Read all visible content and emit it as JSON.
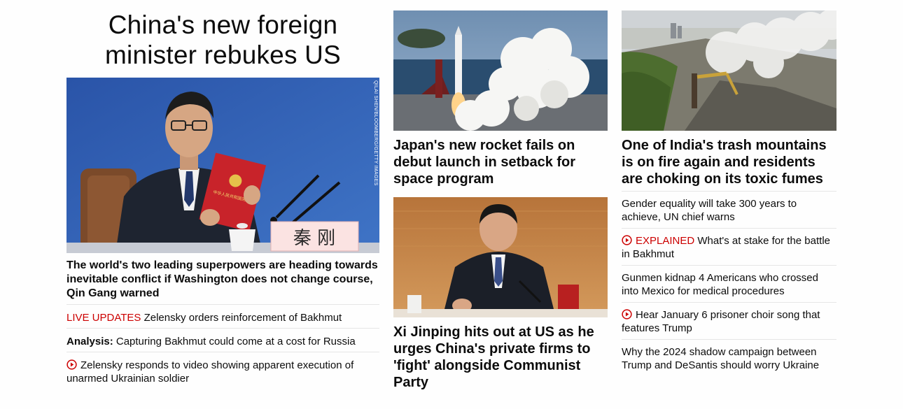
{
  "lead": {
    "headline": "China's new foreign minister rebukes US",
    "image_credit": "QILAI SHEN/BLOOMBERG/GETTY IMAGES",
    "nameplate_text": "秦  刚",
    "book_text": "中华人民共和国宪法",
    "caption": "The world's two leading superpowers are heading towards inevitable conflict if Washington does not change course, Qin Gang warned",
    "related": [
      {
        "label": "LIVE UPDATES",
        "text": "Zelensky orders reinforcement of Bakhmut"
      },
      {
        "label": "Analysis:",
        "text": "Capturing Bakhmut could come at a cost for Russia"
      },
      {
        "icon": "play-video-icon",
        "text": "Zelensky responds to video showing apparent execution of unarmed Ukrainian soldier"
      }
    ]
  },
  "column2": {
    "story1_title": "Japan's new rocket fails on debut launch in setback for space program",
    "story2_title": "Xi Jinping hits out at US as he urges China's private firms to 'fight' alongside Communist Party"
  },
  "column3": {
    "feature_title": "One of India's trash mountains is on fire again and residents are choking on its toxic fumes",
    "items": [
      {
        "text": "Gender equality will take 300 years to achieve, UN chief warns"
      },
      {
        "label": "EXPLAINED",
        "icon": "play-video-icon",
        "text": "What's at stake for the battle in Bakhmut"
      },
      {
        "text": "Gunmen kidnap 4 Americans who crossed into Mexico for medical procedures"
      },
      {
        "icon": "play-video-icon",
        "text": "Hear January 6 prisoner choir song that features Trump"
      },
      {
        "text": "Why the 2024 shadow campaign between Trump and DeSantis should worry Ukraine"
      }
    ]
  },
  "colors": {
    "accent_red": "#cc0000",
    "text": "#0c0c0c",
    "divider": "#e6e6e6"
  }
}
